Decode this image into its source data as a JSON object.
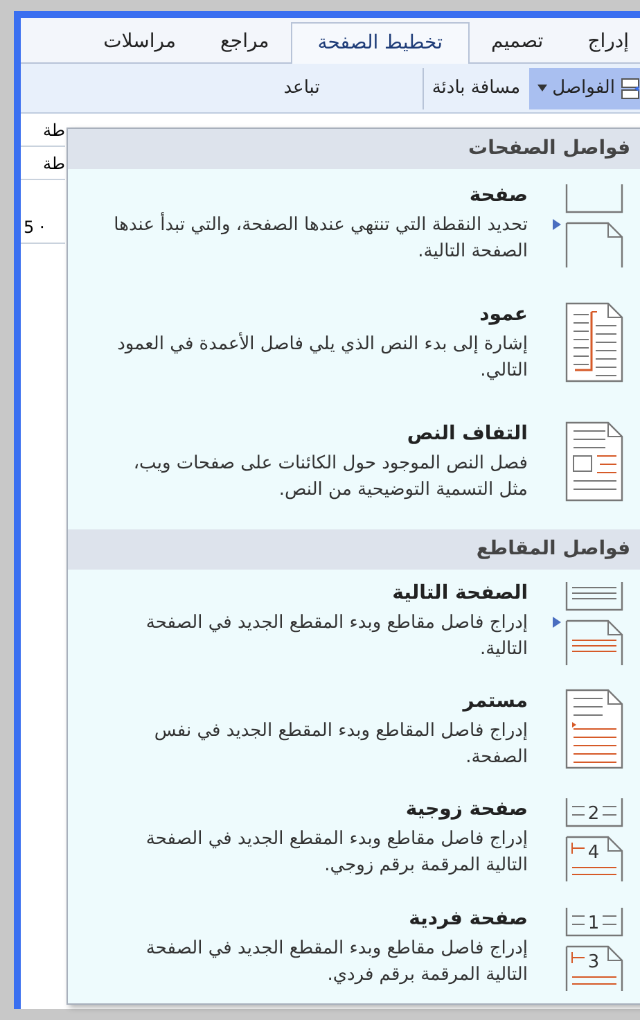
{
  "tabs": [
    {
      "label": "إدراج",
      "selected": false
    },
    {
      "label": "تصميم",
      "selected": false
    },
    {
      "label": "تخطيط الصفحة",
      "selected": true
    },
    {
      "label": "مراجع",
      "selected": false
    },
    {
      "label": "مراسلات",
      "selected": false
    }
  ],
  "ribbon": [
    {
      "label": "الفواصل",
      "kind": "dropdown",
      "selected": true
    },
    {
      "label": "مسافة بادئة",
      "kind": "label",
      "selected": false
    },
    {
      "label": "تباعد",
      "kind": "label",
      "selected": false
    }
  ],
  "document_edge": [
    "طة",
    "طة",
    "5 ·"
  ],
  "menu": {
    "sections": [
      {
        "title": "فواصل الصفحات",
        "items": [
          {
            "title": "صفحة",
            "description": "تحديد النقطة التي تنتهي عندها الصفحة، والتي تبدأ عندها الصفحة التالية.",
            "kind": "page",
            "pointer": true
          },
          {
            "title": "عمود",
            "description": "إشارة إلى بدء النص الذي يلي فاصل الأعمدة في العمود التالي.",
            "kind": "column",
            "pointer": false
          },
          {
            "title": "التفاف النص",
            "description": "فصل النص الموجود حول الكائنات على صفحات ويب، مثل التسمية التوضيحية من النص.",
            "kind": "wrap",
            "pointer": false
          }
        ]
      },
      {
        "title": "فواصل المقاطع",
        "items": [
          {
            "title": "الصفحة التالية",
            "description": "إدراج فاصل مقاطع وبدء المقطع الجديد في الصفحة التالية.",
            "kind": "next",
            "pointer": true
          },
          {
            "title": "مستمر",
            "description": "إدراج فاصل المقاطع وبدء المقطع الجديد في نفس الصفحة.",
            "kind": "continuous",
            "pointer": false
          },
          {
            "title": "صفحة زوجية",
            "description": "إدراج فاصل مقاطع وبدء المقطع الجديد في الصفحة التالية المرقمة برقم زوجي.",
            "kind": "numbered",
            "numbers": [
              "2",
              "4"
            ],
            "pointer": false
          },
          {
            "title": "صفحة فردية",
            "description": "إدراج فاصل مقاطع وبدء المقطع الجديد في الصفحة التالية المرقمة برقم فردي.",
            "kind": "numbered",
            "numbers": [
              "1",
              "3"
            ],
            "pointer": false
          }
        ]
      }
    ]
  }
}
